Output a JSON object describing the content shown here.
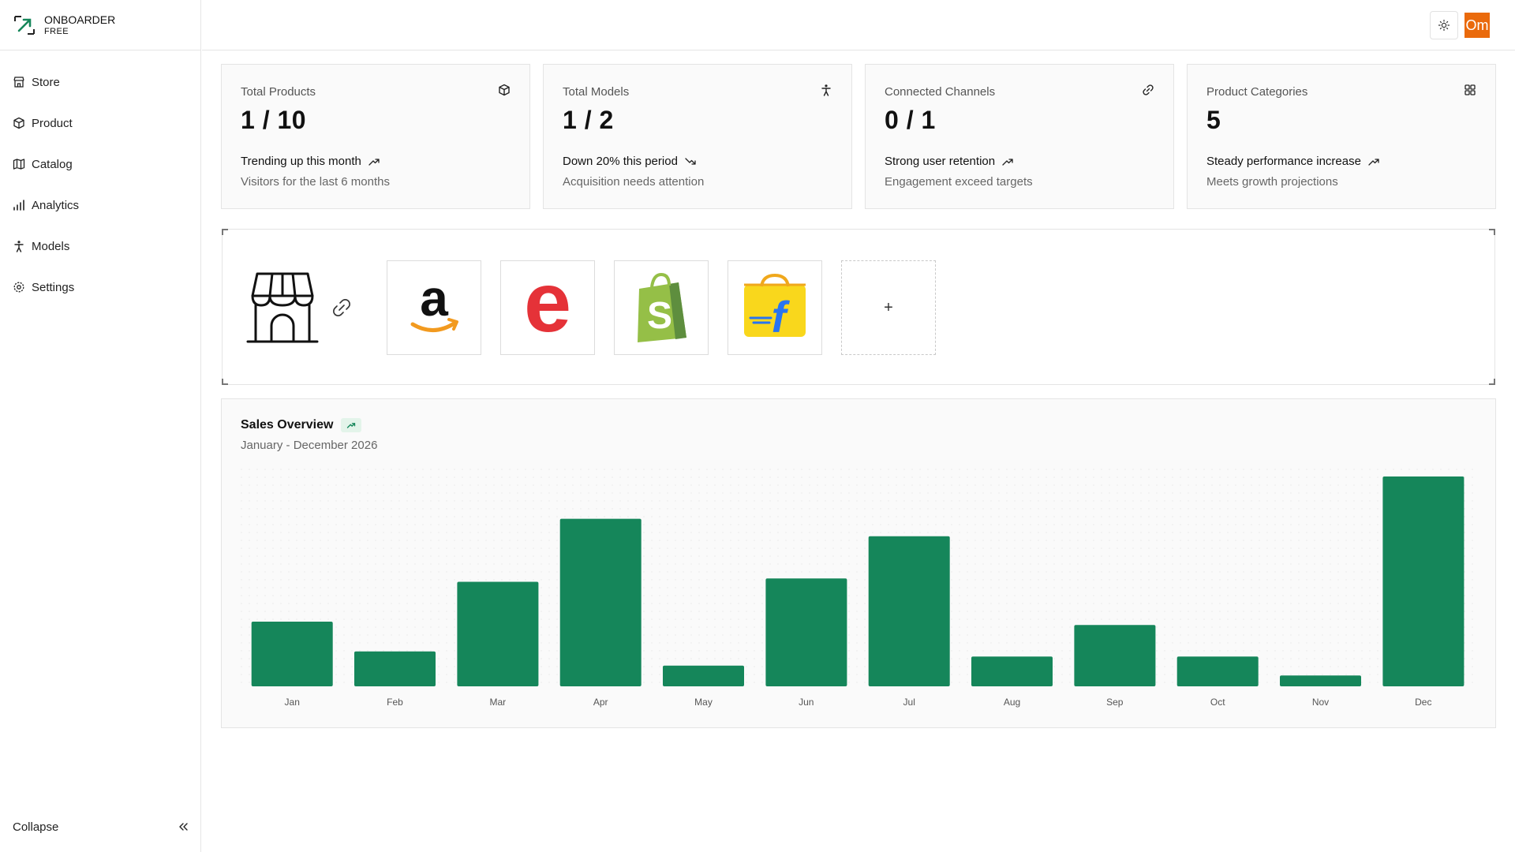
{
  "brand": {
    "name": "ONBOARDER",
    "plan": "FREE"
  },
  "sidebar": {
    "items": [
      {
        "label": "Store",
        "icon": "store-icon"
      },
      {
        "label": "Product",
        "icon": "box-icon"
      },
      {
        "label": "Catalog",
        "icon": "map-icon"
      },
      {
        "label": "Analytics",
        "icon": "bar-chart-icon"
      },
      {
        "label": "Models",
        "icon": "person-icon"
      },
      {
        "label": "Settings",
        "icon": "gear-icon"
      }
    ],
    "collapse_label": "Collapse"
  },
  "topbar": {
    "avatar_initials": "Om",
    "avatar_color": "#ea6a0c"
  },
  "cards": [
    {
      "title": "Total Products",
      "value": "1 / 10",
      "trend": "Trending up this month",
      "trend_dir": "up",
      "sub": "Visitors for the last 6 months",
      "icon": "box-icon"
    },
    {
      "title": "Total Models",
      "value": "1 / 2",
      "trend": "Down 20% this period",
      "trend_dir": "down",
      "sub": "Acquisition needs attention",
      "icon": "person-icon"
    },
    {
      "title": "Connected Channels",
      "value": "0 / 1",
      "trend": "Strong user retention",
      "trend_dir": "up",
      "sub": "Engagement exceed targets",
      "icon": "link-icon"
    },
    {
      "title": "Product Categories",
      "value": "5",
      "trend": "Steady performance increase",
      "trend_dir": "up",
      "sub": "Meets growth projections",
      "icon": "grid-icon"
    }
  ],
  "channels": {
    "items": [
      {
        "name": "amazon-logo"
      },
      {
        "name": "ebay-logo"
      },
      {
        "name": "shopify-logo"
      },
      {
        "name": "flipkart-logo"
      }
    ],
    "add_label": "+"
  },
  "sales": {
    "title": "Sales Overview",
    "subtitle": "January - December 2026"
  },
  "chart_data": {
    "type": "bar",
    "categories": [
      "Jan",
      "Feb",
      "Mar",
      "Apr",
      "May",
      "Jun",
      "Jul",
      "Aug",
      "Sep",
      "Oct",
      "Nov",
      "Dec"
    ],
    "values": [
      78,
      42,
      126,
      202,
      25,
      130,
      181,
      36,
      74,
      36,
      13,
      253
    ],
    "color": "#15865a",
    "grid": true
  },
  "colors": {
    "accent": "#15865a",
    "avatar": "#ea6a0c"
  }
}
